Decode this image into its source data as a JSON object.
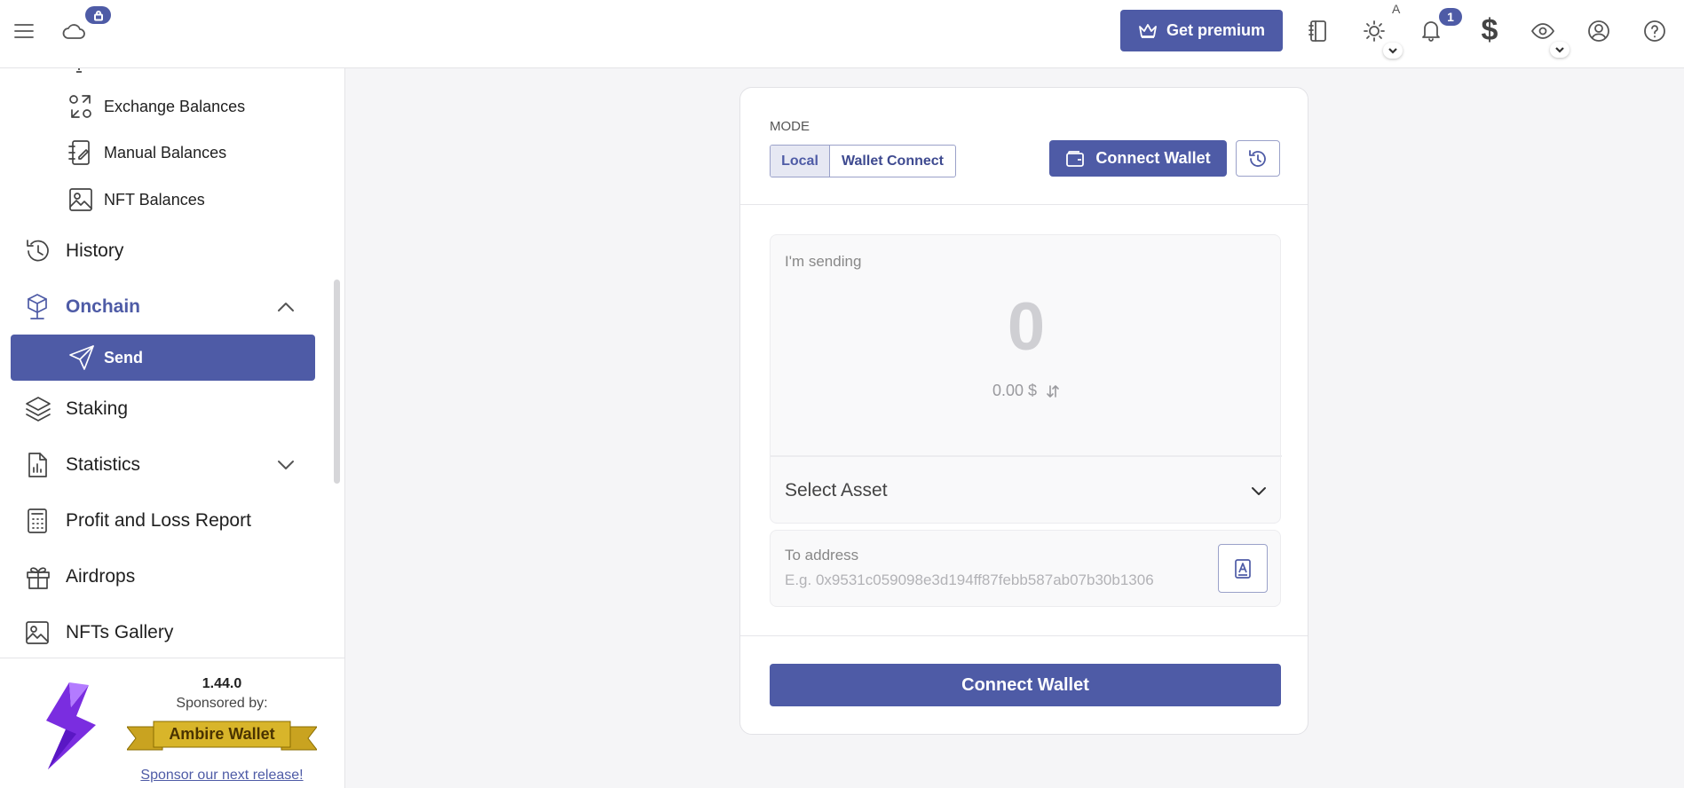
{
  "topbar": {
    "premium_label": "Get premium",
    "notifications_count": "1",
    "theme_letter": "A",
    "currency_symbol": "$"
  },
  "sidebar": {
    "sub_items": [
      {
        "label": "Exchange Balances",
        "icon": "exchange-icon"
      },
      {
        "label": "Manual Balances",
        "icon": "manual-edit-icon"
      },
      {
        "label": "NFT Balances",
        "icon": "image-icon"
      }
    ],
    "items": [
      {
        "label": "History",
        "icon": "history-icon"
      },
      {
        "label": "Onchain",
        "icon": "onchain-icon",
        "expanded": true
      },
      {
        "label": "Send",
        "icon": "send-icon",
        "active": true
      },
      {
        "label": "Staking",
        "icon": "layers-icon"
      },
      {
        "label": "Statistics",
        "icon": "chart-icon",
        "collapsible": true
      },
      {
        "label": "Profit and Loss Report",
        "icon": "calculator-icon"
      },
      {
        "label": "Airdrops",
        "icon": "gift-icon"
      },
      {
        "label": "NFTs Gallery",
        "icon": "image-icon"
      }
    ],
    "sponsor": {
      "version": "1.44.0",
      "sponsored_by": "Sponsored by:",
      "sponsor_name": "Ambire Wallet",
      "link": "Sponsor our next release!"
    }
  },
  "send_card": {
    "mode_label": "MODE",
    "mode_options": [
      "Local",
      "Wallet Connect"
    ],
    "mode_selected": "Local",
    "connect_wallet_top": "Connect Wallet",
    "sending_label": "I'm sending",
    "amount": "0",
    "fiat_amount": "0.00 $",
    "select_asset": "Select Asset",
    "to_address_label": "To address",
    "to_address_placeholder": "E.g. 0x9531c059098e3d194ff87febb587ab07b30b1306",
    "connect_wallet_main": "Connect Wallet"
  },
  "colors": {
    "accent": "#4e5ba6",
    "sponsor_gold": "#d8b52a"
  }
}
